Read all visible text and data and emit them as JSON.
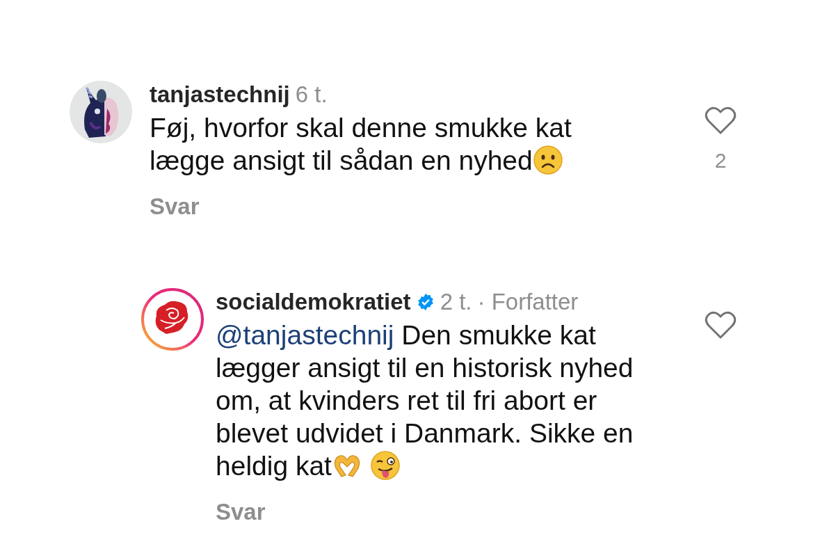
{
  "comments": [
    {
      "username": "tanjastechnij",
      "verified": false,
      "time": "6 t.",
      "text": "Føj, hvorfor skal denne smukke kat lægge ansigt til sådan en nyhed",
      "end_icons": [
        {
          "kind": "frown"
        }
      ],
      "reply_label": "Svar",
      "like_count": "2",
      "liked": false,
      "avatar": {
        "kind": "picture"
      },
      "is_reply": false
    },
    {
      "username": "socialdemokratiet",
      "verified": true,
      "time": "2 t.",
      "author_label": "· Forfatter",
      "mention": "@tanjastechnij",
      "text": "Den smukke kat lægger ansigt til en historisk nyhed om, at kvinders ret til fri abort er blevet udvidet i Danmark. Sikke en heldig kat",
      "end_icons": [
        {
          "kind": "heart-hands"
        },
        {
          "kind": "wink-tongue"
        }
      ],
      "reply_label": "Svar",
      "liked": false,
      "avatar": {
        "kind": "logo"
      },
      "is_reply": true
    }
  ]
}
